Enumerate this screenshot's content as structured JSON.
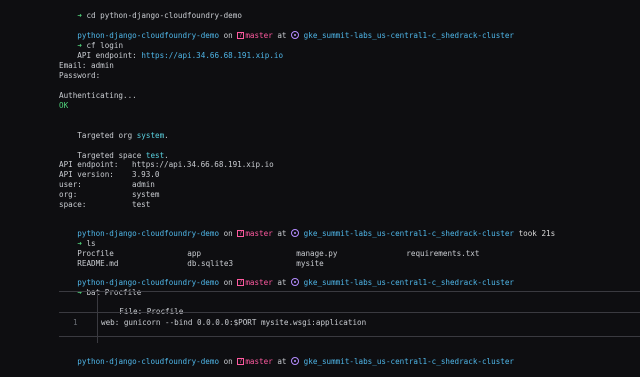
{
  "prompt": {
    "arrow": "➜",
    "dir": "python-django-cloudfoundry-demo",
    "on": "on",
    "branch": "master",
    "at": "at",
    "cluster": "gke_summit-labs_us-central1-c_shedrack-cluster",
    "took_label": "took",
    "took_time": "21s"
  },
  "lines": {
    "cmd1_tail": "➜ cd python-django-cloudfoundry-demo",
    "cmd_cf_login": "cf login",
    "api_endpoint_label": "API endpoint: ",
    "api_endpoint_url": "https://api.34.66.68.191.xip.io",
    "email": "Email: admin",
    "password": "Password:",
    "authenticating": "Authenticating...",
    "ok": "OK",
    "targeted_org_prefix": "Targeted org ",
    "targeted_org": "system",
    "targeted_space_prefix": "Targeted space ",
    "targeted_space": "test",
    "dot": "."
  },
  "info": [
    {
      "label": "API endpoint:",
      "value": "https://api.34.66.68.191.xip.io"
    },
    {
      "label": "API version:",
      "value": "3.93.0"
    },
    {
      "label": "user:",
      "value": "admin"
    },
    {
      "label": "org:",
      "value": "system"
    },
    {
      "label": "space:",
      "value": "test"
    }
  ],
  "cmd_ls": "ls",
  "ls_files": [
    [
      "Procfile",
      "app",
      "manage.py",
      "requirements.txt"
    ],
    [
      "README.md",
      "db.sqlite3",
      "mysite",
      ""
    ]
  ],
  "cmd_bat": "bat Procfile",
  "bat": {
    "file_label": "File: ",
    "file_name": "Procfile",
    "line_number": "1",
    "line_content": "web: gunicorn --bind 0.0.0.0:$PORT mysite.wsgi:application"
  }
}
